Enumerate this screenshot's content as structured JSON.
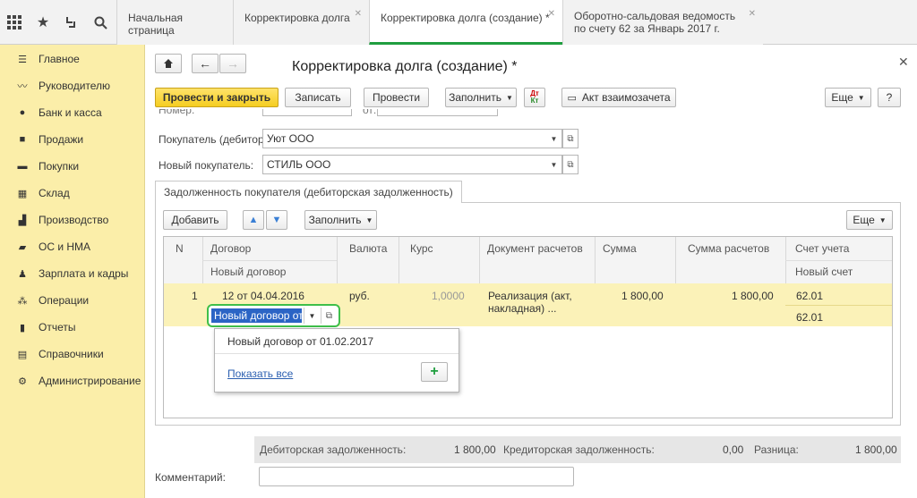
{
  "topbar": {
    "icons": [
      "grid-icon",
      "star-icon",
      "history-icon",
      "search-icon"
    ],
    "tabs": [
      {
        "label": "Начальная страница",
        "closable": false
      },
      {
        "label": "Корректировка долга",
        "closable": true
      },
      {
        "label": "Корректировка долга (создание) *",
        "closable": true
      },
      {
        "label": "Оборотно-сальдовая ведомость по счету 62 за Январь 2017 г.",
        "closable": true
      }
    ]
  },
  "sidebar": {
    "items": [
      {
        "label": "Главное",
        "icon": "menu-icon"
      },
      {
        "label": "Руководителю",
        "icon": "trend-icon"
      },
      {
        "label": "Банк и касса",
        "icon": "coin-icon"
      },
      {
        "label": "Продажи",
        "icon": "bag-icon"
      },
      {
        "label": "Покупки",
        "icon": "cart-icon"
      },
      {
        "label": "Склад",
        "icon": "warehouse-icon"
      },
      {
        "label": "Производство",
        "icon": "factory-icon"
      },
      {
        "label": "ОС и НМА",
        "icon": "truck-icon"
      },
      {
        "label": "Зарплата и кадры",
        "icon": "people-icon"
      },
      {
        "label": "Операции",
        "icon": "operations-icon"
      },
      {
        "label": "Отчеты",
        "icon": "report-icon"
      },
      {
        "label": "Справочники",
        "icon": "book-icon"
      },
      {
        "label": "Администрирование",
        "icon": "gear-icon"
      }
    ]
  },
  "form": {
    "title": "Корректировка долга (создание) *",
    "toolbar": {
      "post_close": "Провести и закрыть",
      "save": "Записать",
      "post": "Провести",
      "fill": "Заполнить",
      "act": "Акт взаимозачета",
      "more": "Еще",
      "help": "?"
    },
    "hidden_number_label": "Номер:",
    "hidden_date_label": "от:",
    "buyer_label": "Покупатель (дебитор):",
    "buyer_value": "Уют ООО",
    "new_buyer_label": "Новый покупатель:",
    "new_buyer_value": "СТИЛЬ ООО",
    "tab_label": "Задолженность покупателя (дебиторская задолженность)",
    "table_toolbar": {
      "add": "Добавить",
      "fill": "Заполнить",
      "more": "Еще"
    },
    "columns": {
      "n": "N",
      "contract": "Договор",
      "new_contract": "Новый договор",
      "currency": "Валюта",
      "rate": "Курс",
      "doc": "Документ расчетов",
      "sum": "Сумма",
      "sum_calc": "Сумма расчетов",
      "account": "Счет учета",
      "new_account": "Новый счет"
    },
    "row": {
      "n": "1",
      "contract": "12 от 04.04.2016",
      "new_contract": "Новый договор от",
      "currency": "руб.",
      "rate": "1,0000",
      "doc": "Реализация (акт, накладная) ...",
      "sum": "1 800,00",
      "sum_calc": "1 800,00",
      "account": "62.01",
      "new_account": "62.01"
    },
    "popup": {
      "option": "Новый договор от 01.02.2017",
      "show_all": "Показать все"
    },
    "totals": {
      "debit_label": "Дебиторская задолженность:",
      "debit_value": "1 800,00",
      "credit_label": "Кредиторская задолженность:",
      "credit_value": "0,00",
      "diff_label": "Разница:",
      "diff_value": "1 800,00"
    },
    "comment_label": "Комментарий:",
    "comment_value": ""
  },
  "colors": {
    "accent": "#f5cd21",
    "sidebar": "#fbeea9",
    "active_tab": "#1f9e3f",
    "row_highlight": "#fbf2b8"
  }
}
